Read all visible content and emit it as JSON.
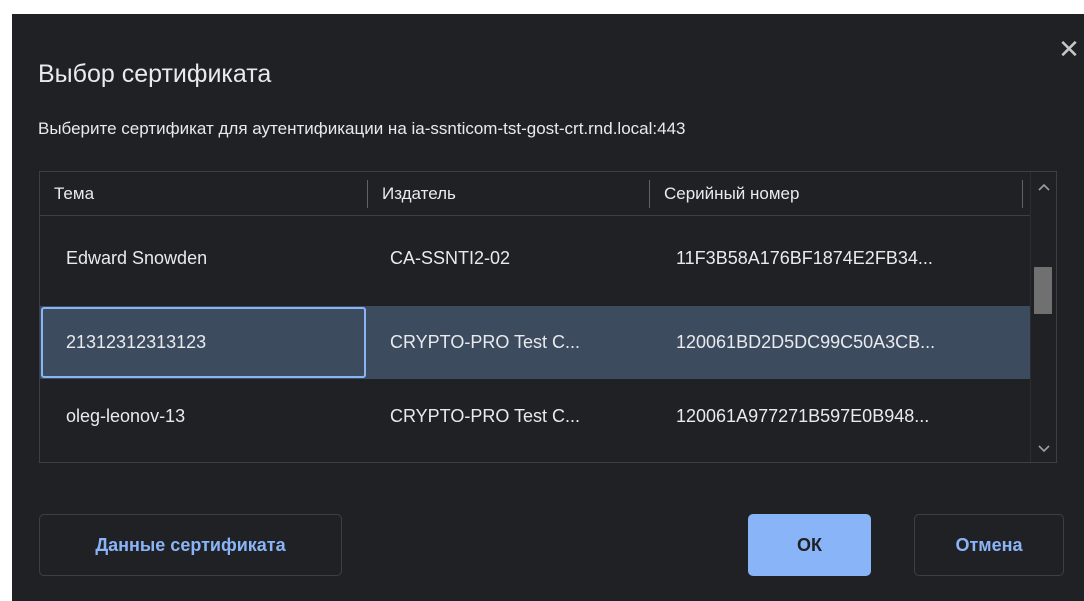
{
  "dialog": {
    "title": "Выбор сертификата",
    "subtitle": "Выберите сертификат для аутентификации на ia-ssnticom-tst-gost-crt.rnd.local:443",
    "close_glyph": "✕"
  },
  "table": {
    "columns": [
      "Тема",
      "Издатель",
      "Серийный номер"
    ],
    "rows": [
      {
        "subject": "Edward Snowden",
        "issuer": "CA-SSNTI2-02",
        "serial": "11F3B58A176BF1874E2FB34...",
        "selected": false
      },
      {
        "subject": "21312312313123",
        "issuer": "CRYPTO-PRO Test C...",
        "serial": "120061BD2D5DC99C50A3CB...",
        "selected": true
      },
      {
        "subject": "oleg-leonov-13",
        "issuer": "CRYPTO-PRO Test C...",
        "serial": "120061A977271B597E0B948...",
        "selected": false
      }
    ]
  },
  "buttons": {
    "details": "Данные сертификата",
    "ok": "ОК",
    "cancel": "Отмена"
  },
  "colors": {
    "dialog_bg": "#202124",
    "selected_row": "#3d4b5f",
    "accent": "#8ab4f8"
  },
  "icons": {
    "close": "close-icon",
    "scroll_up": "chevron-up-icon",
    "scroll_down": "chevron-down-icon"
  }
}
